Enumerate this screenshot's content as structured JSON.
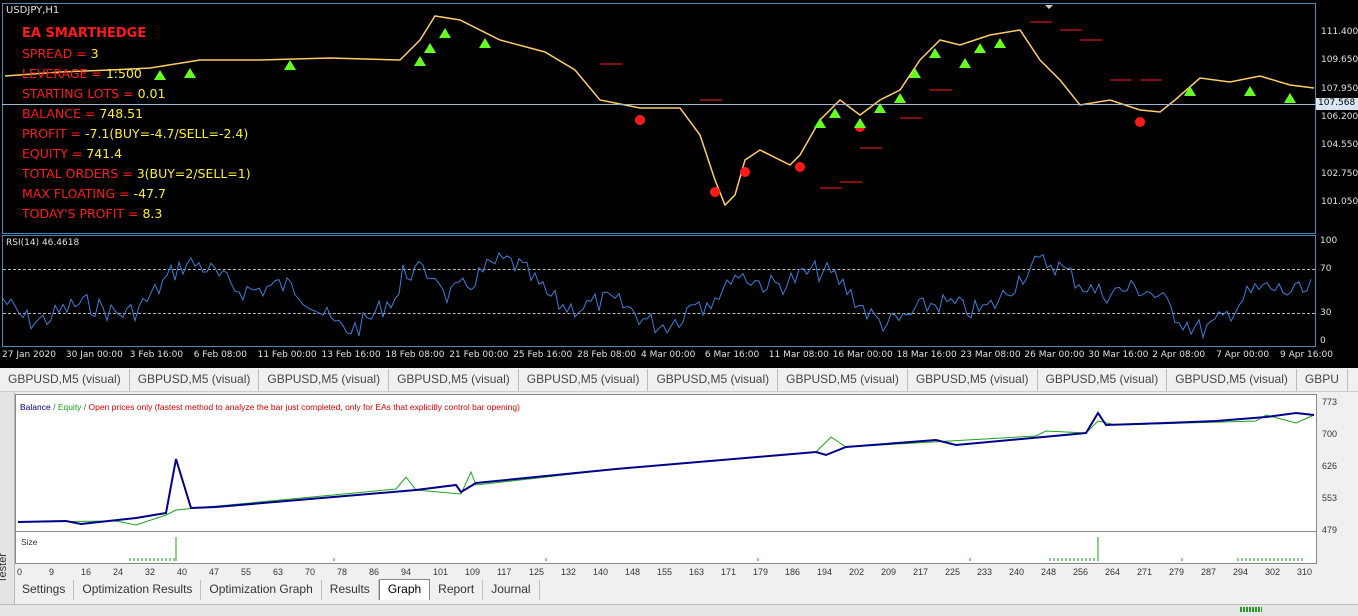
{
  "chart": {
    "symbol_title": "USDJPY,H1",
    "current_price": "107.568",
    "price_axis": [
      "111.400",
      "109.650",
      "107.950",
      "106.200",
      "104.550",
      "102.750",
      "101.050"
    ],
    "time_axis": [
      "27 Jan 2020",
      "30 Jan 00:00",
      "3 Feb 16:00",
      "6 Feb 08:00",
      "11 Feb 00:00",
      "13 Feb 16:00",
      "18 Feb 08:00",
      "21 Feb 00:00",
      "25 Feb 16:00",
      "28 Feb 08:00",
      "4 Mar 00:00",
      "6 Mar 16:00",
      "11 Mar 08:00",
      "16 Mar 00:00",
      "18 Mar 16:00",
      "23 Mar 08:00",
      "26 Mar 00:00",
      "30 Mar 16:00",
      "2 Apr 08:00",
      "7 Apr 00:00",
      "9 Apr 16:00"
    ],
    "rsi_title": "RSI(14) 46.4618",
    "rsi_axis": [
      "100",
      "70",
      "30",
      "0"
    ],
    "colors": {
      "background": "#000000",
      "buy_arrow": "#66ff22",
      "sell_arrow": "#ff1a1a",
      "rsi_line": "#3a7fd9",
      "price_line": "#ffcc66"
    }
  },
  "ea_panel": {
    "title": "EA SMARTHEDGE",
    "lines": [
      {
        "label": "SPREAD = ",
        "value": "3"
      },
      {
        "label": "LEVERAGE = ",
        "value": "1:500"
      },
      {
        "label": "STARTING LOTS = ",
        "value": "0.01"
      },
      {
        "label": "BALANCE = ",
        "value": "748.51"
      },
      {
        "label": "PROFIT = ",
        "value": "-7.1(BUY=-4.7/SELL=-2.4)"
      },
      {
        "label": "EQUITY = ",
        "value": "741.4"
      },
      {
        "label": "TOTAL ORDERS = ",
        "value": "3(BUY=2/SELL=1)"
      },
      {
        "label": "MAX FLOATING = ",
        "value": "-47.7"
      },
      {
        "label": "TODAY'S PROFIT = ",
        "value": "8.3"
      }
    ]
  },
  "symbol_tabs": [
    "GBPUSD,M5 (visual)",
    "GBPUSD,M5 (visual)",
    "GBPUSD,M5 (visual)",
    "GBPUSD,M5 (visual)",
    "GBPUSD,M5 (visual)",
    "GBPUSD,M5 (visual)",
    "GBPUSD,M5 (visual)",
    "GBPUSD,M5 (visual)",
    "GBPUSD,M5 (visual)",
    "GBPUSD,M5 (visual)",
    "GBPU"
  ],
  "tester": {
    "side_label": "Tester",
    "legend": {
      "balance": "Balance",
      "sep1": " / ",
      "equity": "Equity",
      "sep2": " / ",
      "model": "Open prices only (fastest method to analyze the bar just completed, only for EAs that explicitly control bar opening)"
    },
    "size_label": "Size",
    "y_axis": [
      "773",
      "700",
      "626",
      "553",
      "479"
    ],
    "x_axis": [
      "0",
      "9",
      "16",
      "24",
      "32",
      "40",
      "47",
      "55",
      "63",
      "70",
      "78",
      "86",
      "94",
      "101",
      "109",
      "117",
      "125",
      "132",
      "140",
      "148",
      "155",
      "163",
      "171",
      "179",
      "186",
      "194",
      "202",
      "209",
      "217",
      "225",
      "233",
      "240",
      "248",
      "256",
      "264",
      "271",
      "279",
      "287",
      "294",
      "302",
      "310"
    ],
    "tabs": [
      "Settings",
      "Optimization Results",
      "Optimization Graph",
      "Results",
      "Graph",
      "Report",
      "Journal"
    ],
    "active_tab": "Graph",
    "colors": {
      "balance": "#00008b",
      "equity": "#1aa31a",
      "model": "#e00000"
    }
  }
}
